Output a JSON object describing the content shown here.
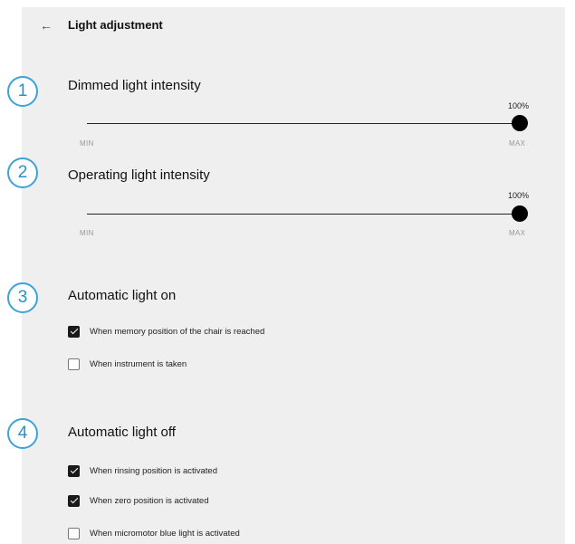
{
  "header": {
    "back_icon": "arrow-left-icon",
    "back_glyph": "←",
    "title": "Light adjustment"
  },
  "colors": {
    "accent": "#3ba3d8",
    "panel_bg": "#efefef",
    "checked": "#1a1a1a"
  },
  "sections": [
    {
      "number": "1",
      "title": "Dimmed light intensity",
      "slider": {
        "value_label": "100%",
        "value": 100,
        "min_label": "MIN",
        "max_label": "MAX"
      }
    },
    {
      "number": "2",
      "title": "Operating light intensity",
      "slider": {
        "value_label": "100%",
        "value": 100,
        "min_label": "MIN",
        "max_label": "MAX"
      }
    },
    {
      "number": "3",
      "title": "Automatic light on",
      "options": [
        {
          "label": "When memory position of the chair is reached",
          "checked": true
        },
        {
          "label": "When instrument is taken",
          "checked": false
        }
      ]
    },
    {
      "number": "4",
      "title": "Automatic light off",
      "options": [
        {
          "label": "When rinsing position is activated",
          "checked": true
        },
        {
          "label": "When zero position is activated",
          "checked": true
        },
        {
          "label": "When micromotor blue light is activated",
          "checked": false
        }
      ]
    }
  ]
}
